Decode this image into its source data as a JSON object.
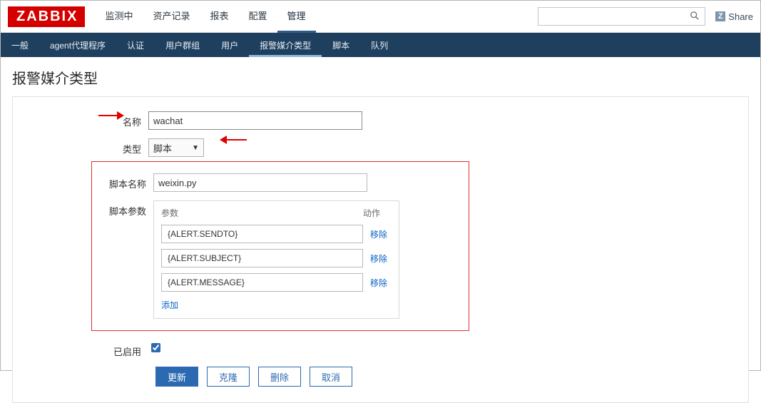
{
  "brand": "ZABBIX",
  "topmenu": [
    "监测中",
    "资产记录",
    "报表",
    "配置",
    "管理"
  ],
  "topmenu_active": 4,
  "share_label": "Share",
  "subnav": [
    "一般",
    "agent代理程序",
    "认证",
    "用户群组",
    "用户",
    "报警媒介类型",
    "脚本",
    "队列"
  ],
  "subnav_active": 5,
  "page_title": "报警媒介类型",
  "form": {
    "name_label": "名称",
    "name_value": "wachat",
    "type_label": "类型",
    "type_value": "脚本",
    "script_name_label": "脚本名称",
    "script_name_value": "weixin.py",
    "script_params_label": "脚本参数",
    "param_col_param": "参数",
    "param_col_action": "动作",
    "params": [
      {
        "value": "{ALERT.SENDTO}"
      },
      {
        "value": "{ALERT.SUBJECT}"
      },
      {
        "value": "{ALERT.MESSAGE}"
      }
    ],
    "remove_label": "移除",
    "add_label": "添加",
    "enabled_label": "已启用",
    "enabled_checked": true
  },
  "buttons": {
    "update": "更新",
    "clone": "克隆",
    "delete": "删除",
    "cancel": "取消"
  },
  "search": {
    "placeholder": ""
  }
}
